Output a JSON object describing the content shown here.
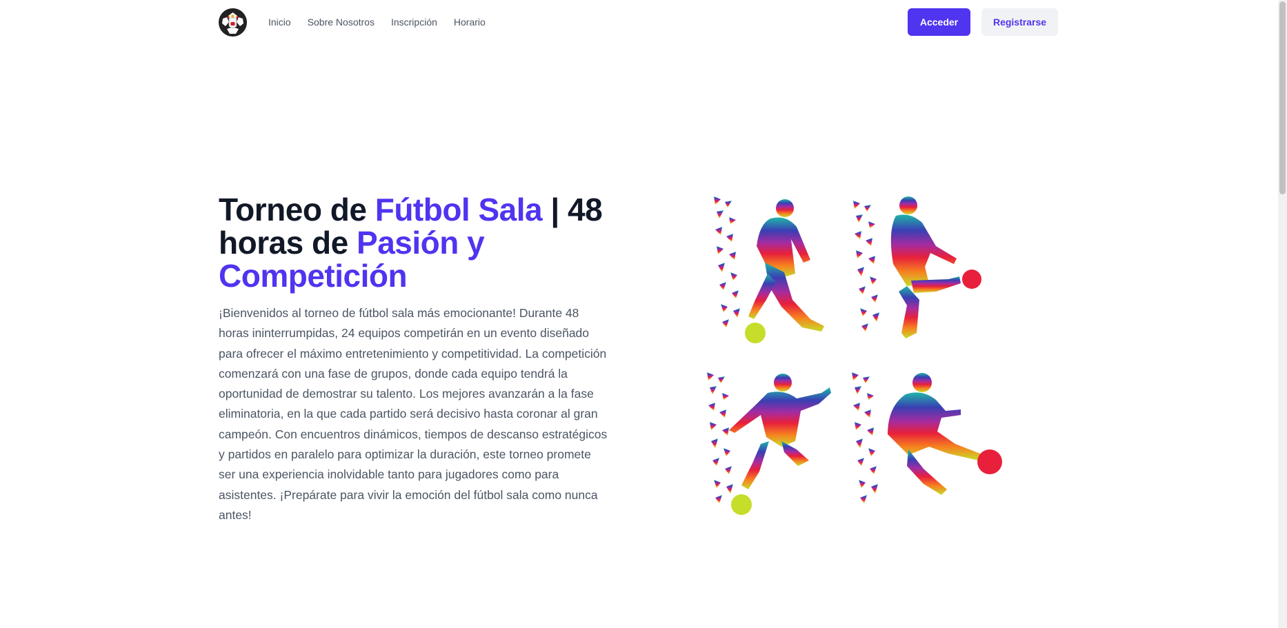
{
  "nav": {
    "links": [
      "Inicio",
      "Sobre Nosotros",
      "Inscripción",
      "Horario"
    ],
    "login_label": "Acceder",
    "register_label": "Registrarse"
  },
  "hero": {
    "title_part1": "Torneo de ",
    "title_accent1": "Fútbol Sala",
    "title_part2": " | 48 horas de ",
    "title_accent2": "Pasión y Competición",
    "body": "¡Bienvenidos al torneo de fútbol sala más emocionante! Durante 48 horas ininterrumpidas, 24 equipos competirán en un evento diseñado para ofrecer el máximo entretenimiento y competitividad. La competición comenzará con una fase de grupos, donde cada equipo tendrá la oportunidad de demostrar su talento. Los mejores avanzarán a la fase eliminatoria, en la que cada partido será decisivo hasta coronar al gran campeón. Con encuentros dinámicos, tiempos de descanso estratégicos y partidos en paralelo para optimizar la duración, este torneo promete ser una experiencia inolvidable tanto para jugadores como para asistentes. ¡Prepárate para vivir la emoción del fútbol sala como nunca antes!"
  },
  "colors": {
    "accent": "#4f34f0",
    "heading": "#111827",
    "body": "#4b5563",
    "secondary_button_bg": "#f1f2f5"
  },
  "icons": {
    "logo": "club-crest-icon",
    "illustration": "soccer-players-illustration"
  }
}
